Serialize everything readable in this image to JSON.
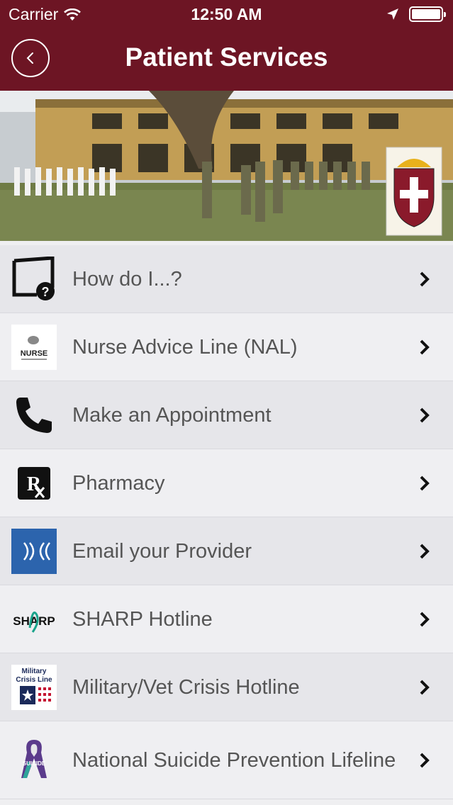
{
  "status_bar": {
    "carrier": "Carrier",
    "time": "12:50 AM"
  },
  "header": {
    "title": "Patient Services"
  },
  "colors": {
    "brand": "#6d1524",
    "row_alt": "#e6e6ea",
    "row": "#efeff2"
  },
  "banner": {
    "description_icon": "crest-logo"
  },
  "menu": {
    "items": [
      {
        "label": "How do I...?",
        "icon": "question-document-icon"
      },
      {
        "label": "Nurse Advice Line (NAL)",
        "icon": "nurse-logo-icon",
        "icon_text": "NURSE"
      },
      {
        "label": "Make an Appointment",
        "icon": "phone-icon"
      },
      {
        "label": "Pharmacy",
        "icon": "rx-icon"
      },
      {
        "label": "Email your Provider",
        "icon": "email-provider-icon"
      },
      {
        "label": "SHARP Hotline",
        "icon": "sharp-logo-icon",
        "icon_text": "SHARP"
      },
      {
        "label": "Military/Vet Crisis Hotline",
        "icon": "crisis-line-icon",
        "icon_text": "Military Crisis Line"
      },
      {
        "label": "National Suicide Prevention Lifeline",
        "icon": "suicide-prevention-icon",
        "icon_text": "SUICIDE"
      }
    ]
  }
}
